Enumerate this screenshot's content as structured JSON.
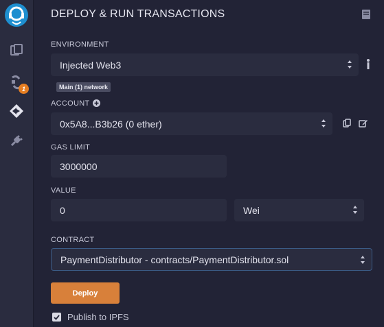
{
  "header": {
    "title": "DEPLOY & RUN TRANSACTIONS"
  },
  "sidebar": {
    "icons": [
      "remix-logo",
      "file-explorers-icon",
      "compile-icon",
      "deploy-run-icon",
      "plugin-manager-icon"
    ],
    "compile_badge": "1"
  },
  "environment": {
    "label": "ENVIRONMENT",
    "value": "Injected Web3",
    "network_badge": "Main (1) network"
  },
  "account": {
    "label": "ACCOUNT",
    "value": "0x5A8...B3b26 (0 ether)"
  },
  "gas_limit": {
    "label": "GAS LIMIT",
    "value": "3000000"
  },
  "value": {
    "label": "VALUE",
    "amount": "0",
    "unit": "Wei"
  },
  "contract": {
    "label": "CONTRACT",
    "value": "PaymentDistributor - contracts/PaymentDistributor.sol"
  },
  "actions": {
    "deploy_label": "Deploy",
    "publish_label": "Publish to IPFS",
    "publish_checked": true
  },
  "colors": {
    "accent": "#d8803a",
    "badge": "#e67e22",
    "panel_bg": "#222336",
    "field_bg": "#2a2c3f"
  }
}
